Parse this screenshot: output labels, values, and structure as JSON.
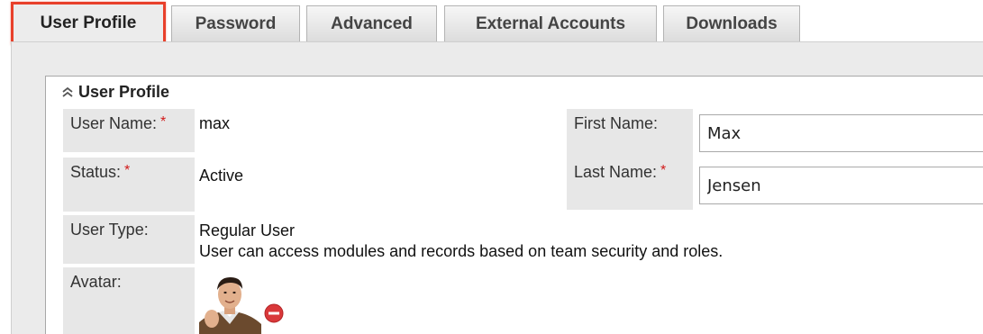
{
  "tabs": [
    {
      "label": "User Profile",
      "active": true
    },
    {
      "label": "Password",
      "active": false
    },
    {
      "label": "Advanced",
      "active": false
    },
    {
      "label": "External Accounts",
      "active": false
    },
    {
      "label": "Downloads",
      "active": false
    }
  ],
  "section": {
    "title": "User Profile"
  },
  "fields": {
    "user_name": {
      "label": "User Name:",
      "required_marker": "*",
      "value": "max"
    },
    "status": {
      "label": "Status:",
      "required_marker": "*",
      "value": "Active"
    },
    "user_type": {
      "label": "User Type:",
      "value": "Regular User",
      "description": "User can access modules and records based on team security and roles."
    },
    "avatar": {
      "label": "Avatar:"
    },
    "first_name": {
      "label": "First Name:",
      "value": "Max"
    },
    "last_name": {
      "label": "Last Name:",
      "required_marker": "*",
      "value": "Jensen"
    }
  },
  "colors": {
    "active_tab_highlight": "#e8402b",
    "required_marker": "#d11a1a",
    "label_background": "#e7e7e7",
    "remove_icon": "#d9383a"
  },
  "icons": {
    "collapse": "double-chevron-up-icon",
    "remove": "minus-circle-icon"
  }
}
